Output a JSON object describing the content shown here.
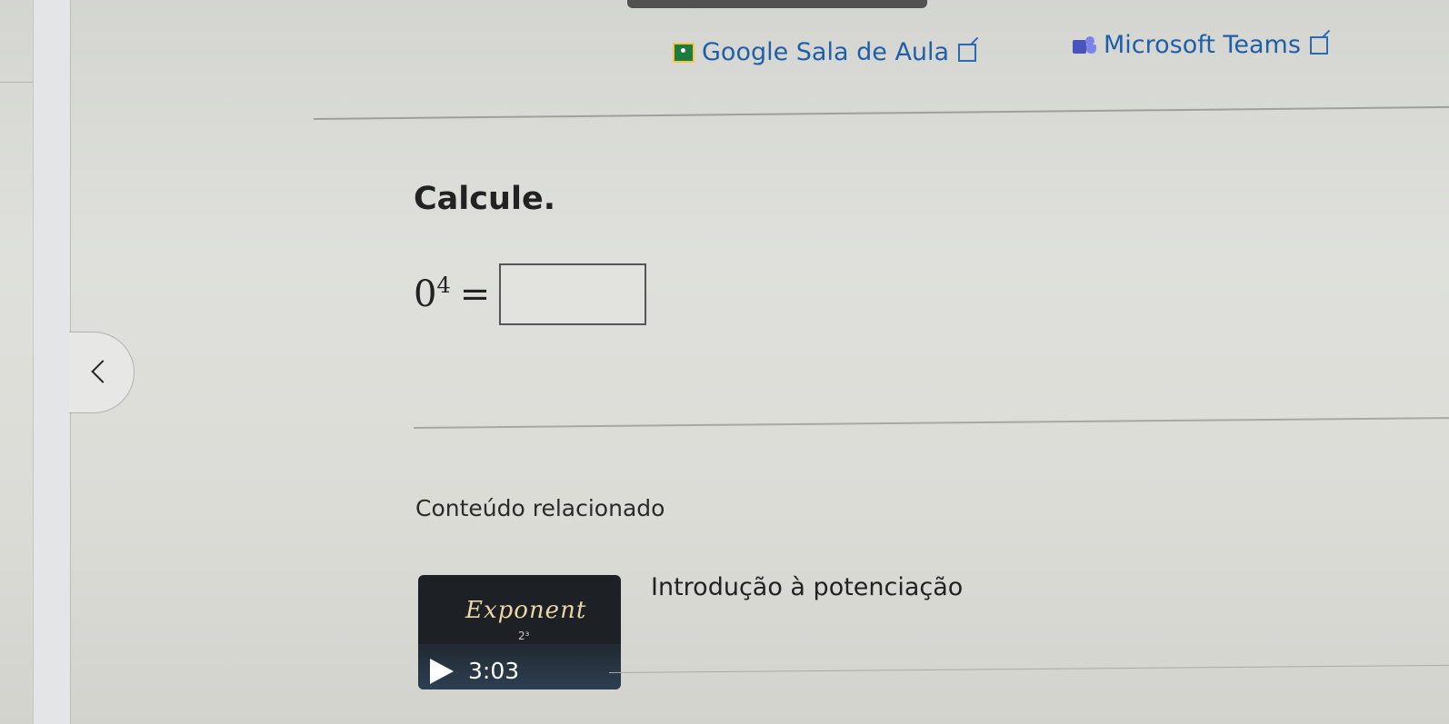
{
  "links": {
    "google_classroom": "Google Sala de Aula",
    "microsoft_teams": "Microsoft Teams"
  },
  "exercise": {
    "instruction": "Calcule.",
    "base": "0",
    "exponent": "4",
    "equals": "=",
    "answer_value": ""
  },
  "related": {
    "heading": "Conteúdo relacionado",
    "video": {
      "thumbnail_text": "Exponent",
      "thumbnail_formula": "2³",
      "duration": "3:03",
      "title": "Introdução à potenciação"
    }
  },
  "icons": {
    "google_classroom": "google-classroom-icon",
    "teams": "teams-icon",
    "external": "external-link-icon",
    "previous": "chevron-left-icon",
    "play": "play-icon"
  },
  "colors": {
    "link": "#1e5fa8",
    "background": "#dcdcd6"
  }
}
